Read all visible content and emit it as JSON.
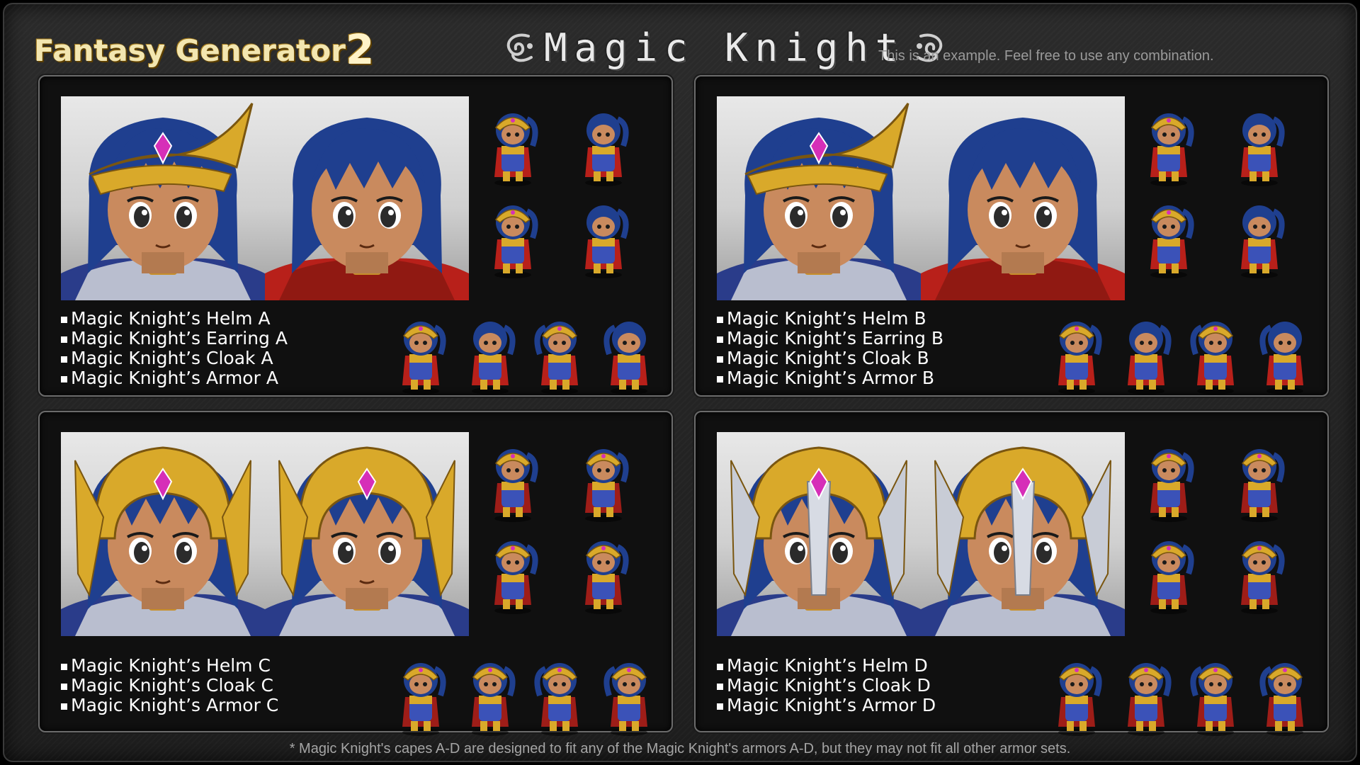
{
  "header": {
    "app_title": "Fantasy Generator",
    "app_title_number": "2",
    "class_title": "Magic Knight",
    "subtitle": "This is an example. Feel free to use any combination."
  },
  "panels": [
    {
      "id": "A",
      "items": [
        "Magic Knight’s Helm A",
        "Magic Knight’s Earring A",
        "Magic Knight’s Cloak A",
        "Magic Knight’s Armor A"
      ],
      "helm_style": "winged-visor",
      "cape_color": "#b8201a"
    },
    {
      "id": "B",
      "items": [
        "Magic Knight’s Helm B",
        "Magic Knight’s Earring B",
        "Magic Knight’s Cloak B",
        "Magic Knight’s Armor B"
      ],
      "helm_style": "crown-visor",
      "cape_color": "#b8201a"
    },
    {
      "id": "C",
      "items": [
        "Magic Knight’s Helm C",
        "Magic Knight’s Cloak C",
        "Magic Knight’s Armor C"
      ],
      "helm_style": "full-gold",
      "cape_color": "#9e1d18"
    },
    {
      "id": "D",
      "items": [
        "Magic Knight’s Helm D",
        "Magic Knight’s Cloak D",
        "Magic Knight’s Armor D"
      ],
      "helm_style": "full-silver-gold",
      "cape_color": "#9e1d18"
    }
  ],
  "footnote": "* Magic Knight's capes A-D are designed to fit any of the Magic Knight's armors A-D, but they may not fit all other armor sets.",
  "colors": {
    "background": "#222222",
    "panel_bg": "#101010",
    "panel_border": "#6b6b6b",
    "gold": "#d9a92a",
    "hair": "#1f3f8f",
    "skin": "#c98a5e",
    "gem": "#d62fb8",
    "cape": "#b8201a"
  }
}
